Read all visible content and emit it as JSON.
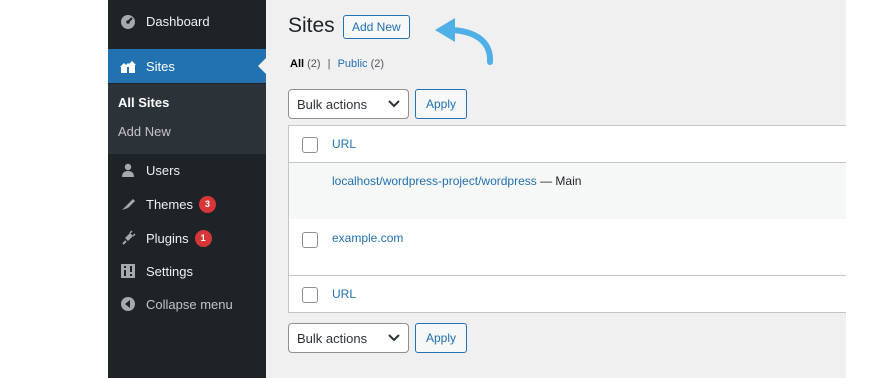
{
  "sidebar": {
    "items": [
      {
        "label": "Dashboard",
        "icon": "dashboard-icon"
      },
      {
        "label": "Sites",
        "icon": "sites-icon"
      },
      {
        "label": "Users",
        "icon": "users-icon"
      },
      {
        "label": "Themes",
        "icon": "themes-icon",
        "badge": "3"
      },
      {
        "label": "Plugins",
        "icon": "plugins-icon",
        "badge": "1"
      },
      {
        "label": "Settings",
        "icon": "settings-icon"
      },
      {
        "label": "Collapse menu",
        "icon": "collapse-icon"
      }
    ],
    "submenu": [
      "All Sites",
      "Add New"
    ]
  },
  "main": {
    "title": "Sites",
    "add_new": "Add New",
    "filters": {
      "all": "All",
      "all_count": "(2)",
      "separator": "|",
      "public": "Public",
      "public_count": "(2)"
    },
    "bulk_actions": "Bulk actions",
    "apply": "Apply",
    "table": {
      "column_header": "URL",
      "rows": [
        {
          "url": "localhost/wordpress-project/wordpress",
          "suffix": " — Main"
        },
        {
          "url": "example.com",
          "suffix": ""
        }
      ]
    }
  },
  "colors": {
    "accent": "#2271b1",
    "sidebar_bg": "#1d2327",
    "badge": "#d63638",
    "arrow": "#4fb0e8"
  }
}
